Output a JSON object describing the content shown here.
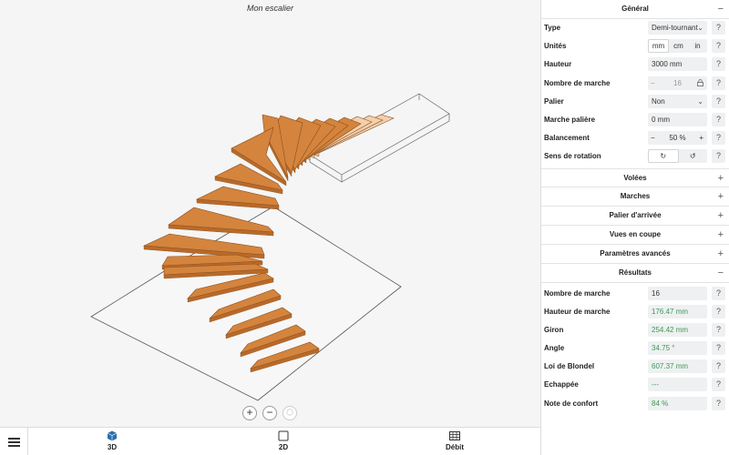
{
  "viewport": {
    "title": "Mon escalier",
    "zoom_in": "+",
    "zoom_out": "−",
    "reset_icon": "⬡"
  },
  "bottom_nav": {
    "items": [
      {
        "label": "3D",
        "icon": "cube-icon"
      },
      {
        "label": "2D",
        "icon": "square-icon"
      },
      {
        "label": "Débit",
        "icon": "table-icon"
      }
    ]
  },
  "panel": {
    "general": {
      "title": "Général",
      "toggle": "−",
      "type": {
        "label": "Type",
        "value": "Demi-tournant",
        "arrow": "⌄"
      },
      "units": {
        "label": "Unités",
        "options": [
          "mm",
          "cm",
          "in"
        ],
        "selected": "mm"
      },
      "height": {
        "label": "Hauteur",
        "value": "3000 mm"
      },
      "steps": {
        "label": "Nombre de marche",
        "minus": "−",
        "value": "16",
        "plus": "+",
        "lock": "🔒"
      },
      "landing": {
        "label": "Palier",
        "value": "Non",
        "arrow": "⌄"
      },
      "landing_step": {
        "label": "Marche palière",
        "value": "0 mm"
      },
      "balance": {
        "label": "Balancement",
        "minus": "−",
        "value": "50 %",
        "plus": "+"
      },
      "rotation": {
        "label": "Sens de rotation",
        "cw": "↻",
        "ccw": "↺"
      }
    },
    "help": "?",
    "collapsed": [
      {
        "title": "Volées",
        "toggle": "+"
      },
      {
        "title": "Marches",
        "toggle": "+"
      },
      {
        "title": "Palier d'arrivée",
        "toggle": "+"
      },
      {
        "title": "Vues en coupe",
        "toggle": "+"
      },
      {
        "title": "Paramètres avancés",
        "toggle": "+"
      }
    ],
    "results": {
      "title": "Résultats",
      "toggle": "−",
      "rows": [
        {
          "label": "Nombre de marche",
          "value": "16"
        },
        {
          "label": "Hauteur de marche",
          "value": "176.47 mm"
        },
        {
          "label": "Giron",
          "value": "254.42 mm"
        },
        {
          "label": "Angle",
          "value": "34.75 °"
        },
        {
          "label": "Loi de Blondel",
          "value": "607.37 mm"
        },
        {
          "label": "Echappée",
          "value": "---"
        },
        {
          "label": "Note de confort",
          "value": "84 %"
        }
      ]
    }
  },
  "colors": {
    "tread": "#d4843d",
    "tread_edge": "#8a4f1d",
    "ghost_tread": "#f2d0ae",
    "accent_blue": "#2d6fae",
    "result_green": "#3a9a55"
  }
}
